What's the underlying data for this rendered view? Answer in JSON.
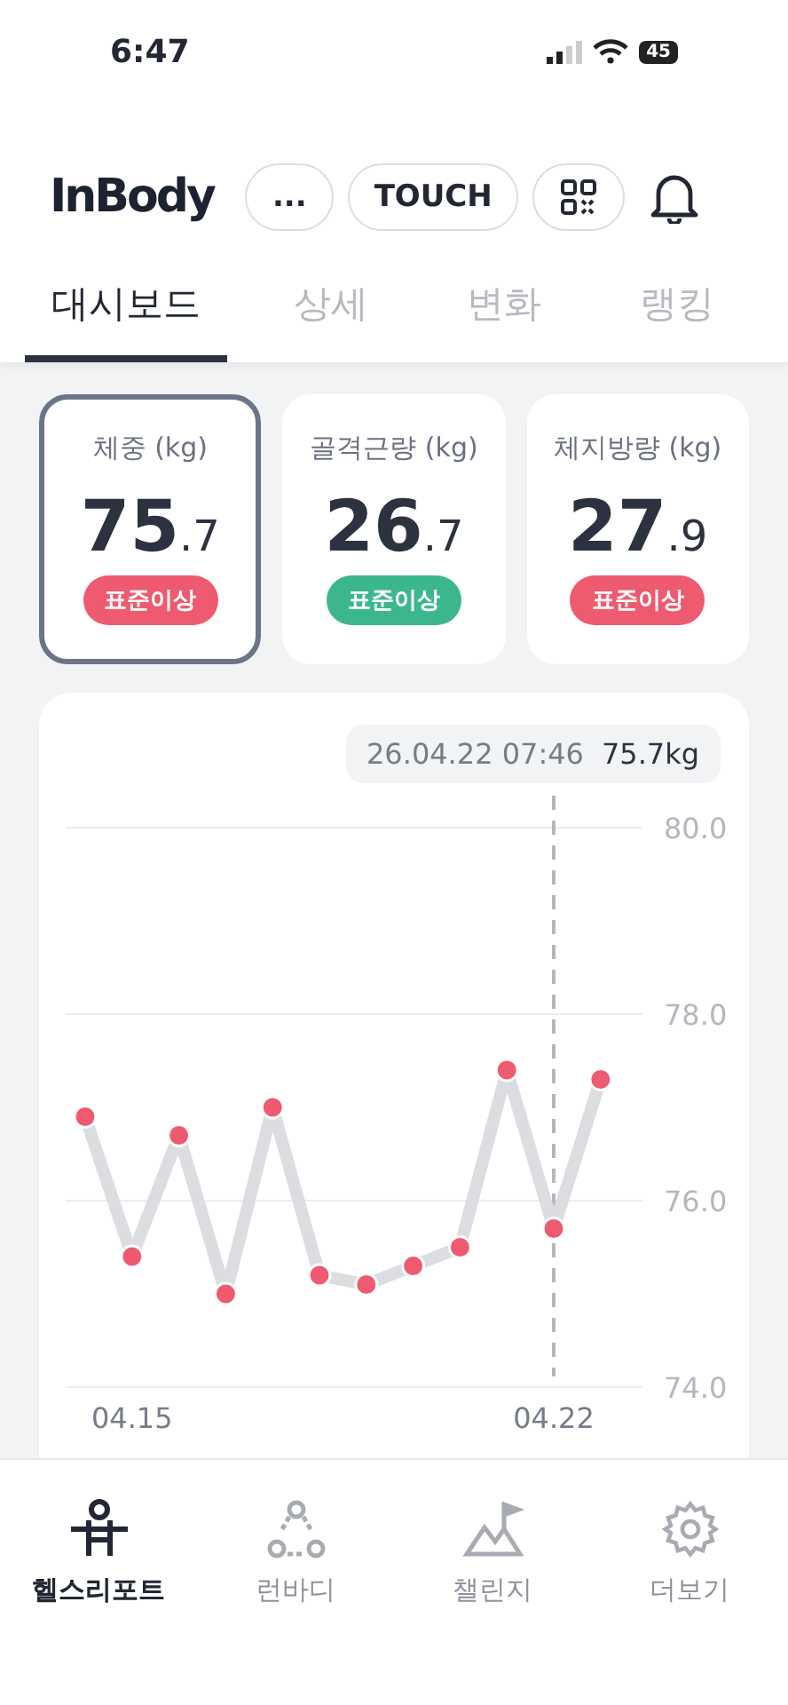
{
  "status_bar": {
    "time": "6:47",
    "battery": "45"
  },
  "header": {
    "logo": "InBody",
    "buttons": [
      {
        "kind": "text",
        "label": "..."
      },
      {
        "kind": "text",
        "label": "TOUCH"
      },
      {
        "kind": "qr"
      }
    ]
  },
  "tabs": [
    {
      "label": "대시보드",
      "selected": true
    },
    {
      "label": "상세",
      "selected": false
    },
    {
      "label": "변화",
      "selected": false
    },
    {
      "label": "랭킹",
      "selected": false
    }
  ],
  "metrics": [
    {
      "name": "체중 (kg)",
      "value": "75",
      "decimal": ".7",
      "status": "표준이상",
      "color": "#ee5a6f",
      "selected": true
    },
    {
      "name": "골격근량 (kg)",
      "value": "26",
      "decimal": ".7",
      "status": "표준이상",
      "color": "#3cb68f",
      "selected": false
    },
    {
      "name": "체지방량 (kg)",
      "value": "27",
      "decimal": ".9",
      "status": "표준이상",
      "color": "#ee5a6f",
      "selected": false
    }
  ],
  "chart": {
    "tooltip": {
      "date": "26.04.22 07:46",
      "value": "75.7kg"
    },
    "chart_data": {
      "type": "line",
      "categories": [
        null,
        "04.15",
        null,
        null,
        null,
        null,
        null,
        null,
        null,
        null,
        "04.22",
        null
      ],
      "series": [
        {
          "color": "#ee5a6f",
          "marker": "circle",
          "values": [
            76.9,
            75.4,
            76.7,
            75.0,
            77.0,
            75.2,
            75.1,
            75.3,
            75.5,
            77.4,
            75.7,
            77.3
          ]
        }
      ],
      "ylim": [
        74,
        80
      ],
      "yticks": [
        {
          "value": 80,
          "label": "80.0"
        },
        {
          "value": 78,
          "label": "78.0"
        },
        {
          "value": 76,
          "label": "76.0"
        },
        {
          "value": 74,
          "label": "74.0"
        }
      ]
    }
  },
  "nav": [
    {
      "kind": "figure",
      "label": "헬스리포트",
      "selected": true
    },
    {
      "kind": "nodes",
      "label": "런바디",
      "selected": false
    },
    {
      "kind": "mountain",
      "label": "챌린지",
      "selected": false
    },
    {
      "kind": "gear",
      "label": "더보기",
      "selected": false
    }
  ]
}
